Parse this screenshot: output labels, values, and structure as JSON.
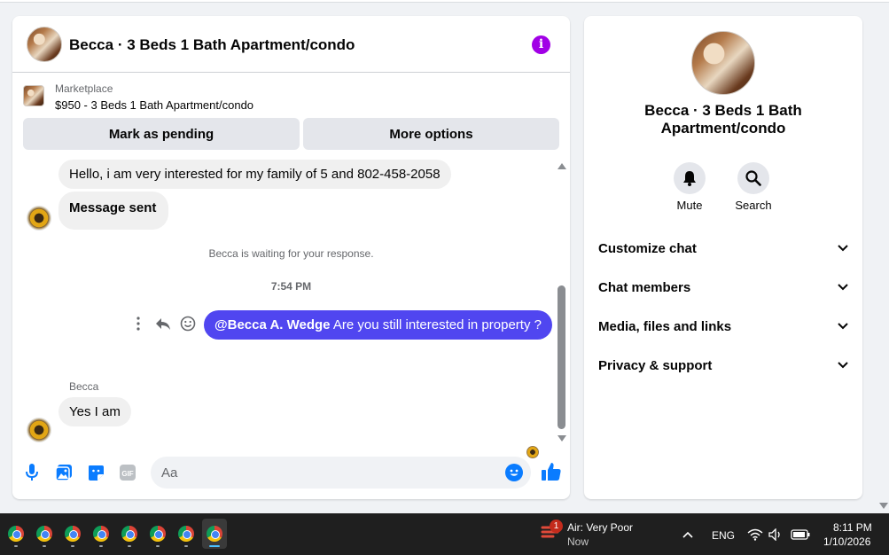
{
  "chat": {
    "title": "Becca · 3 Beds 1 Bath Apartment/condo",
    "info_icon": "info-icon",
    "marketplace": {
      "label": "Marketplace",
      "listing": "$950 - 3 Beds 1 Bath Apartment/condo",
      "pending_button": "Mark as pending",
      "more_button": "More options"
    },
    "messages": {
      "incoming_1": "Hello, i am very interested for my family of 5 and 802-458-2058",
      "incoming_2": "Message sent",
      "system_note": "Becca is waiting for your response.",
      "timestamp": "7:54 PM",
      "outgoing_mention": "@Becca A. Wedge",
      "outgoing_text": " Are you still interested in property ?",
      "sender_name": "Becca",
      "incoming_3": "Yes I am"
    },
    "composer": {
      "placeholder": "Aa"
    }
  },
  "info_panel": {
    "title": "Becca · 3 Beds 1 Bath Apartment/condo",
    "mute_label": "Mute",
    "search_label": "Search",
    "rows": {
      "customize": "Customize chat",
      "members": "Chat members",
      "media": "Media, files and links",
      "privacy": "Privacy & support"
    }
  },
  "taskbar": {
    "weather_badge": "1",
    "weather_text": "Air: Very Poor",
    "weather_sub": "Now",
    "language": "ENG",
    "time": "8:11 PM",
    "date": "1/10/2026"
  },
  "colors": {
    "accent": "#5046f0",
    "messenger_blue": "#0a7cff",
    "info_purple": "#a100e6"
  }
}
